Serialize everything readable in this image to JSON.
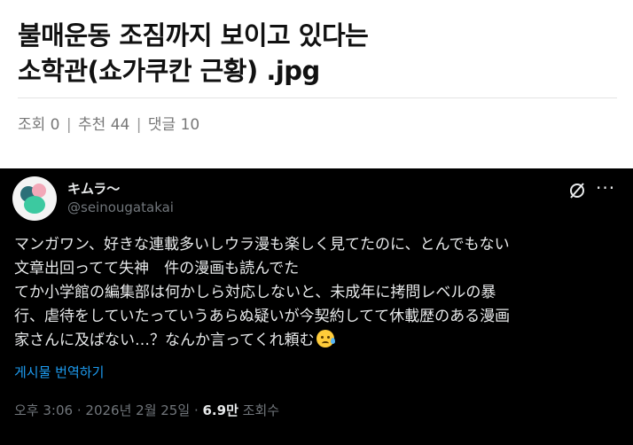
{
  "post": {
    "title_line1": "불매운동 조짐까지 보이고 있다는",
    "title_line2": "소학관(쇼가쿠칸 근황) .jpg",
    "views_label": "조회 0",
    "recommend_label": "추천 44",
    "comments_label": "댓글 10",
    "separator": "|"
  },
  "tweet": {
    "display_name": "キムラ〜",
    "handle": "@seinougatakai",
    "avatar_icon": "avatar-blob-icon",
    "grok_icon": "grok-icon",
    "more_icon": "more-horizontal-icon",
    "text_lines": [
      "マンガワン、好きな連載多いしウラ漫も楽しく見てたのに、とんでもない",
      "文章出回ってて失神　件の漫画も読んでた",
      "てか小学館の編集部は何かしら対応しないと、未成年に拷問レベルの暴",
      "行、虐待をしていたっていうあらぬ疑いが今契約してて休載歴のある漫画",
      "家さんに及ばない…？なんか言ってくれ頼む"
    ],
    "emoji_name": "crying-face-icon",
    "translate_label": "게시물 번역하기",
    "time": "오후 3:06",
    "dot": "·",
    "date": "2026년 2월 25일",
    "views_count": "6.9만",
    "views_suffix": "조회수"
  },
  "colors": {
    "tweet_bg": "#000000",
    "link_blue": "#1d9bf0",
    "muted_gray": "#71767b"
  }
}
